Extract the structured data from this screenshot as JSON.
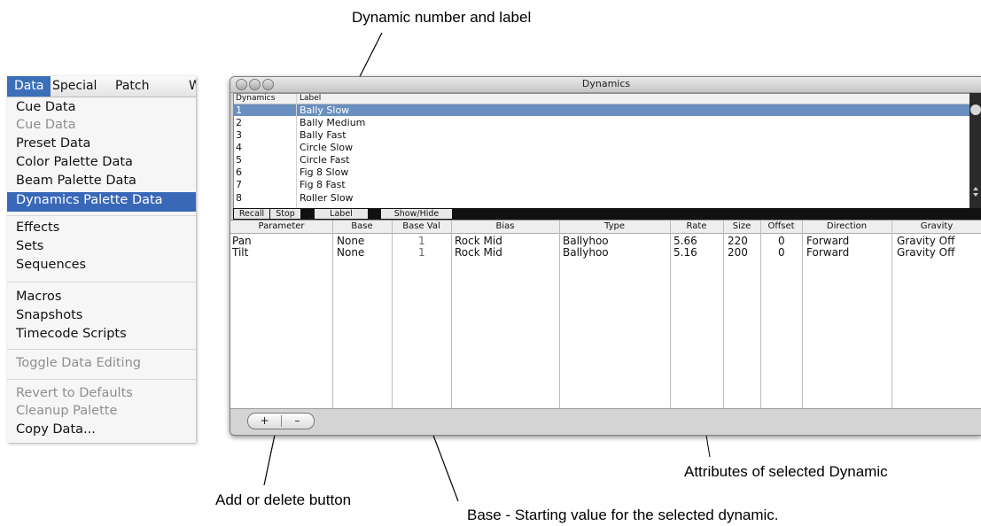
{
  "callouts": {
    "dynamic_number_label": "Dynamic number and label",
    "attributes": "Attributes of selected Dynamic",
    "add_delete": "Add or delete button",
    "base": "Base - Starting value for the selected dynamic."
  },
  "menu": {
    "bar": [
      "Data",
      "Special",
      "Patch",
      "W"
    ],
    "items": [
      {
        "label": "Cue Data",
        "enabled": true
      },
      {
        "label": "Cue Data",
        "enabled": false
      },
      {
        "label": "Preset Data",
        "enabled": true
      },
      {
        "label": "Color Palette Data",
        "enabled": true
      },
      {
        "label": "Beam Palette Data",
        "enabled": true
      },
      {
        "label": "Dynamics Palette Data",
        "enabled": true,
        "highlighted": true
      },
      {
        "label": "Effects",
        "enabled": true
      },
      {
        "label": "Sets",
        "enabled": true
      },
      {
        "label": "Sequences",
        "enabled": true
      },
      {
        "label": "Macros",
        "enabled": true
      },
      {
        "label": "Snapshots",
        "enabled": true
      },
      {
        "label": "Timecode Scripts",
        "enabled": true
      },
      {
        "label": "Toggle Data Editing",
        "enabled": false
      },
      {
        "label": "Revert to Defaults",
        "enabled": false
      },
      {
        "label": "Cleanup Palette",
        "enabled": false
      },
      {
        "label": "Copy Data...",
        "enabled": true
      }
    ]
  },
  "window": {
    "title": "Dynamics",
    "dyn_headers": [
      "Dynamics",
      "Label"
    ],
    "dynamics": [
      {
        "num": "1",
        "label": "Bally Slow",
        "selected": true
      },
      {
        "num": "2",
        "label": "Bally Medium"
      },
      {
        "num": "3",
        "label": "Bally Fast"
      },
      {
        "num": "4",
        "label": "Circle Slow"
      },
      {
        "num": "5",
        "label": "Circle Fast"
      },
      {
        "num": "6",
        "label": "Fig 8 Slow"
      },
      {
        "num": "7",
        "label": "Fig 8 Fast"
      },
      {
        "num": "8",
        "label": "Roller Slow"
      }
    ],
    "buttons": [
      "Recall",
      "Stop",
      "Label",
      "Show/Hide"
    ],
    "attr_headers": [
      "Parameter",
      "Base",
      "Base Val",
      "Bias",
      "Type",
      "Rate",
      "Size",
      "Offset",
      "Direction",
      "Gravity"
    ],
    "attr_rows": [
      [
        "Pan",
        "None",
        "1",
        "Rock Mid",
        "Ballyhoo",
        "5.66",
        "220",
        "0",
        "Forward",
        "Gravity Off"
      ],
      [
        "Tilt",
        "None",
        "1",
        "Rock Mid",
        "Ballyhoo",
        "5.16",
        "200",
        "0",
        "Forward",
        "Gravity Off"
      ]
    ],
    "add_label": "+",
    "delete_label": "–"
  },
  "colors": {
    "menu_highlight": "#3968b8",
    "row_selected": "#6a8fc0"
  }
}
